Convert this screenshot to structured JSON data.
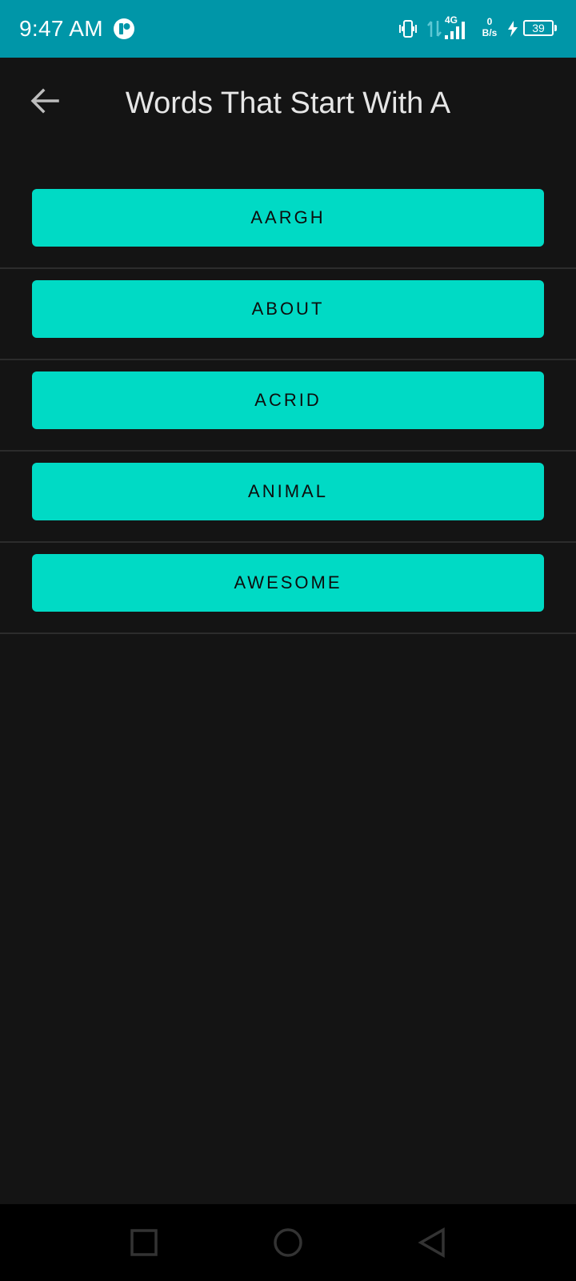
{
  "status_bar": {
    "time": "9:47 AM",
    "network_type": "4G",
    "speed_value": "0",
    "speed_unit": "B/s",
    "battery_level": "39",
    "background_color": "#0096a8"
  },
  "app_bar": {
    "title": "Words That Start With A",
    "back_icon": "arrow-back-icon"
  },
  "words": [
    {
      "label": "AARGH"
    },
    {
      "label": "ABOUT"
    },
    {
      "label": "ACRID"
    },
    {
      "label": "ANIMAL"
    },
    {
      "label": "AWESOME"
    }
  ],
  "colors": {
    "background": "#141414",
    "button": "#00dac5",
    "button_text": "#0d0d0d",
    "title_text": "#e6e6e6"
  },
  "nav_bar": {
    "recents_icon": "square-icon",
    "home_icon": "circle-icon",
    "back_icon": "triangle-back-icon"
  }
}
